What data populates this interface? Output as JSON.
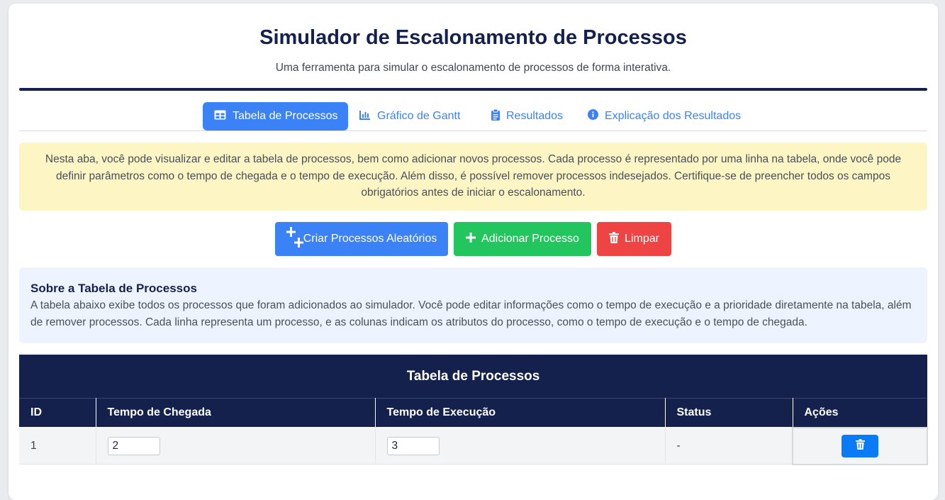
{
  "header": {
    "title": "Simulador de Escalonamento de Processos",
    "subtitle": "Uma ferramenta para simular o escalonamento de processos de forma interativa."
  },
  "tabs": [
    {
      "label": "Tabela de Processos",
      "icon": "table-icon",
      "active": true
    },
    {
      "label": "Gráfico de Gantt",
      "icon": "bar-chart-icon",
      "active": false
    },
    {
      "label": "Resultados",
      "icon": "clipboard-icon",
      "active": false
    },
    {
      "label": "Explicação dos Resultados",
      "icon": "info-circle-icon",
      "active": false
    }
  ],
  "notice": {
    "text": "Nesta aba, você pode visualizar e editar a tabela de processos, bem como adicionar novos processos. Cada processo é representado por uma linha na tabela, onde você pode definir parâmetros como o tempo de chegada e o tempo de execução. Além disso, é possível remover processos indesejados. Certifique-se de preencher todos os campos obrigatórios antes de iniciar o escalonamento."
  },
  "actions": {
    "random_label": "Criar Processos Aleatórios",
    "add_label": "Adicionar Processo",
    "clear_label": "Limpar"
  },
  "about": {
    "heading": "Sobre a Tabela de Processos",
    "text": "A tabela abaixo exibe todos os processos que foram adicionados ao simulador. Você pode editar informações como o tempo de execução e a prioridade diretamente na tabela, além de remover processos. Cada linha representa um processo, e as colunas indicam os atributos do processo, como o tempo de execução e o tempo de chegada."
  },
  "process_table": {
    "caption": "Tabela de Processos",
    "columns": [
      "ID",
      "Tempo de Chegada",
      "Tempo de Execução",
      "Status",
      "Ações"
    ],
    "rows": [
      {
        "id": "1",
        "arrival": "2",
        "burst": "3",
        "status": "-"
      }
    ]
  },
  "colors": {
    "primary": "#15214d",
    "accent_blue": "#3b82f6",
    "green": "#22c55e",
    "red": "#ef4444",
    "notice_bg": "#fdf5c4",
    "about_bg": "#eef4ff",
    "delete_blue": "#0b7bf5"
  }
}
